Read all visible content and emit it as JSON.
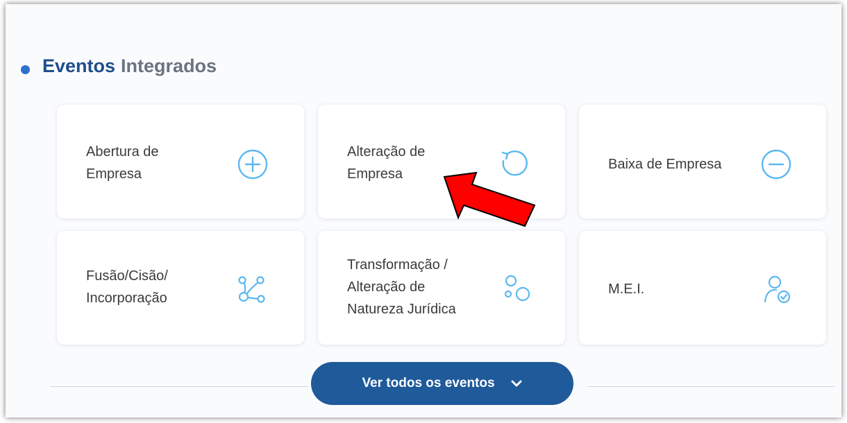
{
  "section": {
    "title_part1": "Eventos",
    "title_part2": "Integrados"
  },
  "cards": [
    {
      "line1": "Abertura de",
      "line2": "Empresa",
      "icon": "plus-circle-icon"
    },
    {
      "line1": "Alteração de",
      "line2": "Empresa",
      "icon": "refresh-icon"
    },
    {
      "line1": "Baixa de Empresa",
      "icon": "minus-circle-icon"
    },
    {
      "line1": "Fusão/Cisão/",
      "line2": "Incorporação",
      "icon": "merge-nodes-icon"
    },
    {
      "line1": "Transformação /",
      "line2": "Alteração de",
      "line3": "Natureza Jurídica",
      "icon": "circles-icon"
    },
    {
      "line1": "M.E.I.",
      "icon": "user-check-icon"
    }
  ],
  "button": {
    "label": "Ver todos os eventos"
  },
  "colors": {
    "accent": "#1f5a9a",
    "title_blue": "#1e4e8c",
    "title_gray": "#6b7280",
    "icon": "#5bb8f0",
    "arrow": "#ff0000"
  }
}
